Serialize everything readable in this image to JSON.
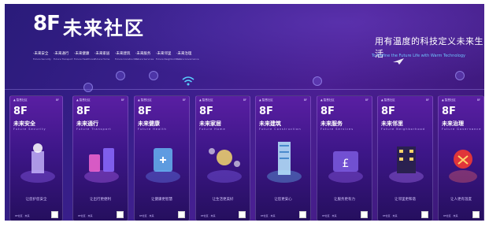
{
  "header": {
    "logo_mark": "8F",
    "logo_title": "未来社区",
    "slogan": "用有温度的科技定义未来生活",
    "slogan_en": "To Define the Future Life with Warm Technology"
  },
  "features": [
    {
      "zh": "·未来安全",
      "en": "Future Security"
    },
    {
      "zh": "·未来通行",
      "en": "Future Transport"
    },
    {
      "zh": "·未来健康",
      "en": "Future Healthcare"
    },
    {
      "zh": "·未来家居",
      "en": "Future Home"
    },
    {
      "zh": "·未来建筑",
      "en": "Future Construction"
    },
    {
      "zh": "·未来服务",
      "en": "Future Services"
    },
    {
      "zh": "·未来邻里",
      "en": "Future Neighborhood"
    },
    {
      "zh": "·未来治理",
      "en": "Future Governance"
    }
  ],
  "panels": [
    {
      "brand": "▲ 智慧社区",
      "code": "8F",
      "mark": "8F",
      "title": "未来安全",
      "sub": "Future Security",
      "caption": "让您护您安全",
      "footer": "8F社区 · 未来",
      "accent": "#9b6bff"
    },
    {
      "brand": "▲ 智慧社区",
      "code": "8F",
      "mark": "8F",
      "title": "未来通行",
      "sub": "Future Transport",
      "caption": "让出行更便利",
      "footer": "8F社区 · 未来",
      "accent": "#c06bff"
    },
    {
      "brand": "▲ 智慧社区",
      "code": "8F",
      "mark": "8F",
      "title": "未来健康",
      "sub": "Future Health",
      "caption": "让健康更智慧",
      "footer": "8F社区 · 未来",
      "accent": "#6b8bff"
    },
    {
      "brand": "▲ 智慧社区",
      "code": "8F",
      "mark": "8F",
      "title": "未来家居",
      "sub": "Future Home",
      "caption": "让生活更美好",
      "footer": "8F社区 · 未来",
      "accent": "#8b6bff"
    },
    {
      "brand": "▲ 智慧社区",
      "code": "8F",
      "mark": "8F",
      "title": "未来建筑",
      "sub": "Future Construction",
      "caption": "让您更安心",
      "footer": "8F社区 · 未来",
      "accent": "#6bc8ff"
    },
    {
      "brand": "▲ 智慧社区",
      "code": "8F",
      "mark": "8F",
      "title": "未来服务",
      "sub": "Future Services",
      "caption": "让服务更有力",
      "footer": "8F社区 · 未来",
      "accent": "#a06bff"
    },
    {
      "brand": "▲ 智慧社区",
      "code": "8F",
      "mark": "8F",
      "title": "未来邻里",
      "sub": "Future Neighborhood",
      "caption": "让邻里更和谐",
      "footer": "8F社区 · 未来",
      "accent": "#b47bff"
    },
    {
      "brand": "▲ 智慧社区",
      "code": "8F",
      "mark": "8F",
      "title": "未来治理",
      "sub": "Future Governance",
      "caption": "让人更有温度",
      "footer": "8F社区 · 未来",
      "accent": "#ff6b6b"
    }
  ],
  "timeline_icons": [
    "home-icon",
    "heart-icon",
    "camera-icon",
    "wifi-icon",
    "person-icon",
    "pin-icon"
  ],
  "colors": {
    "background": "#3a1f8c",
    "panel_top": "#5a1fa3",
    "accent_blue": "#6fc3ff"
  }
}
